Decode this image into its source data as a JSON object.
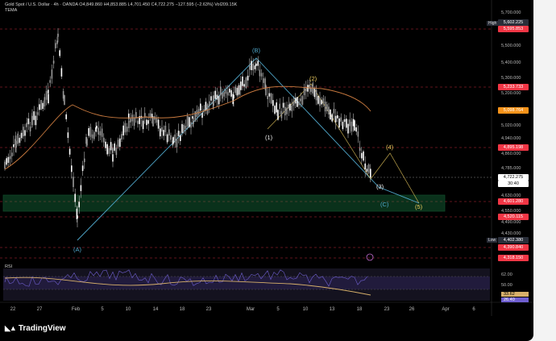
{
  "header": {
    "title": "Gold Spot / U.S. Dollar · 4h · OANDA  O4,849.860 H4,853.885 L4,701.450 C4,722.275 −127.595 (−2.63%) Vol209.15K",
    "indicator": "TEMA"
  },
  "price_axis": [
    "5,700.000",
    "5,500.000",
    "5,400.000",
    "5,300.000",
    "5,200.000",
    "5,020.000",
    "4,940.000",
    "4,860.000",
    "4,785.000",
    "4,630.000",
    "4,550.000",
    "4,490.000",
    "4,430.000"
  ],
  "price_tags": [
    {
      "text": "5,602.225",
      "color": "#2a2e39",
      "label": "High"
    },
    {
      "text": "5,595.853",
      "color": "#f23645"
    },
    {
      "text": "5,233.733",
      "color": "#f23645"
    },
    {
      "text": "5,098.764",
      "color": "#f7931a"
    },
    {
      "text": "4,895.198",
      "color": "#f23645"
    },
    {
      "text": "4,722.275",
      "color": "#ffffff",
      "text_color": "#000"
    },
    {
      "text": "30:40",
      "color": "#ffffff",
      "text_color": "#000"
    },
    {
      "text": "4,601.280",
      "color": "#f23645"
    },
    {
      "text": "4,520.115",
      "color": "#f23645"
    },
    {
      "text": "4,402.380",
      "color": "#2a2e39",
      "label": "Low"
    },
    {
      "text": "4,390.840",
      "color": "#f23645"
    },
    {
      "text": "4,318.150",
      "color": "#f23645"
    }
  ],
  "rsi": {
    "label": "RSI",
    "levels": [
      "62.00",
      "50.00",
      "33.62",
      "26.40"
    ]
  },
  "x_axis": [
    "22",
    "27",
    "Feb",
    "5",
    "10",
    "14",
    "18",
    "23",
    "Mar",
    "5",
    "10",
    "13",
    "18",
    "23",
    "26",
    "Apr",
    "6"
  ],
  "waves": {
    "A": "(A)",
    "B": "(B)",
    "C": "(C)",
    "w1": "(1)",
    "w2": "(2)",
    "w3": "(3)",
    "w4": "(4)",
    "w5": "(5)"
  },
  "brand": "TradingView",
  "colors": {
    "bg": "#000000",
    "up": "#ffffff",
    "down": "#ffffff",
    "tema": "#c97a3f",
    "green_zone": "#1e8c4e",
    "wave_blue": "#4fa6c9",
    "wave_yellow": "#f0d060",
    "rsi": "#d7b06a",
    "rsi_ma": "#6f5fd0"
  }
}
